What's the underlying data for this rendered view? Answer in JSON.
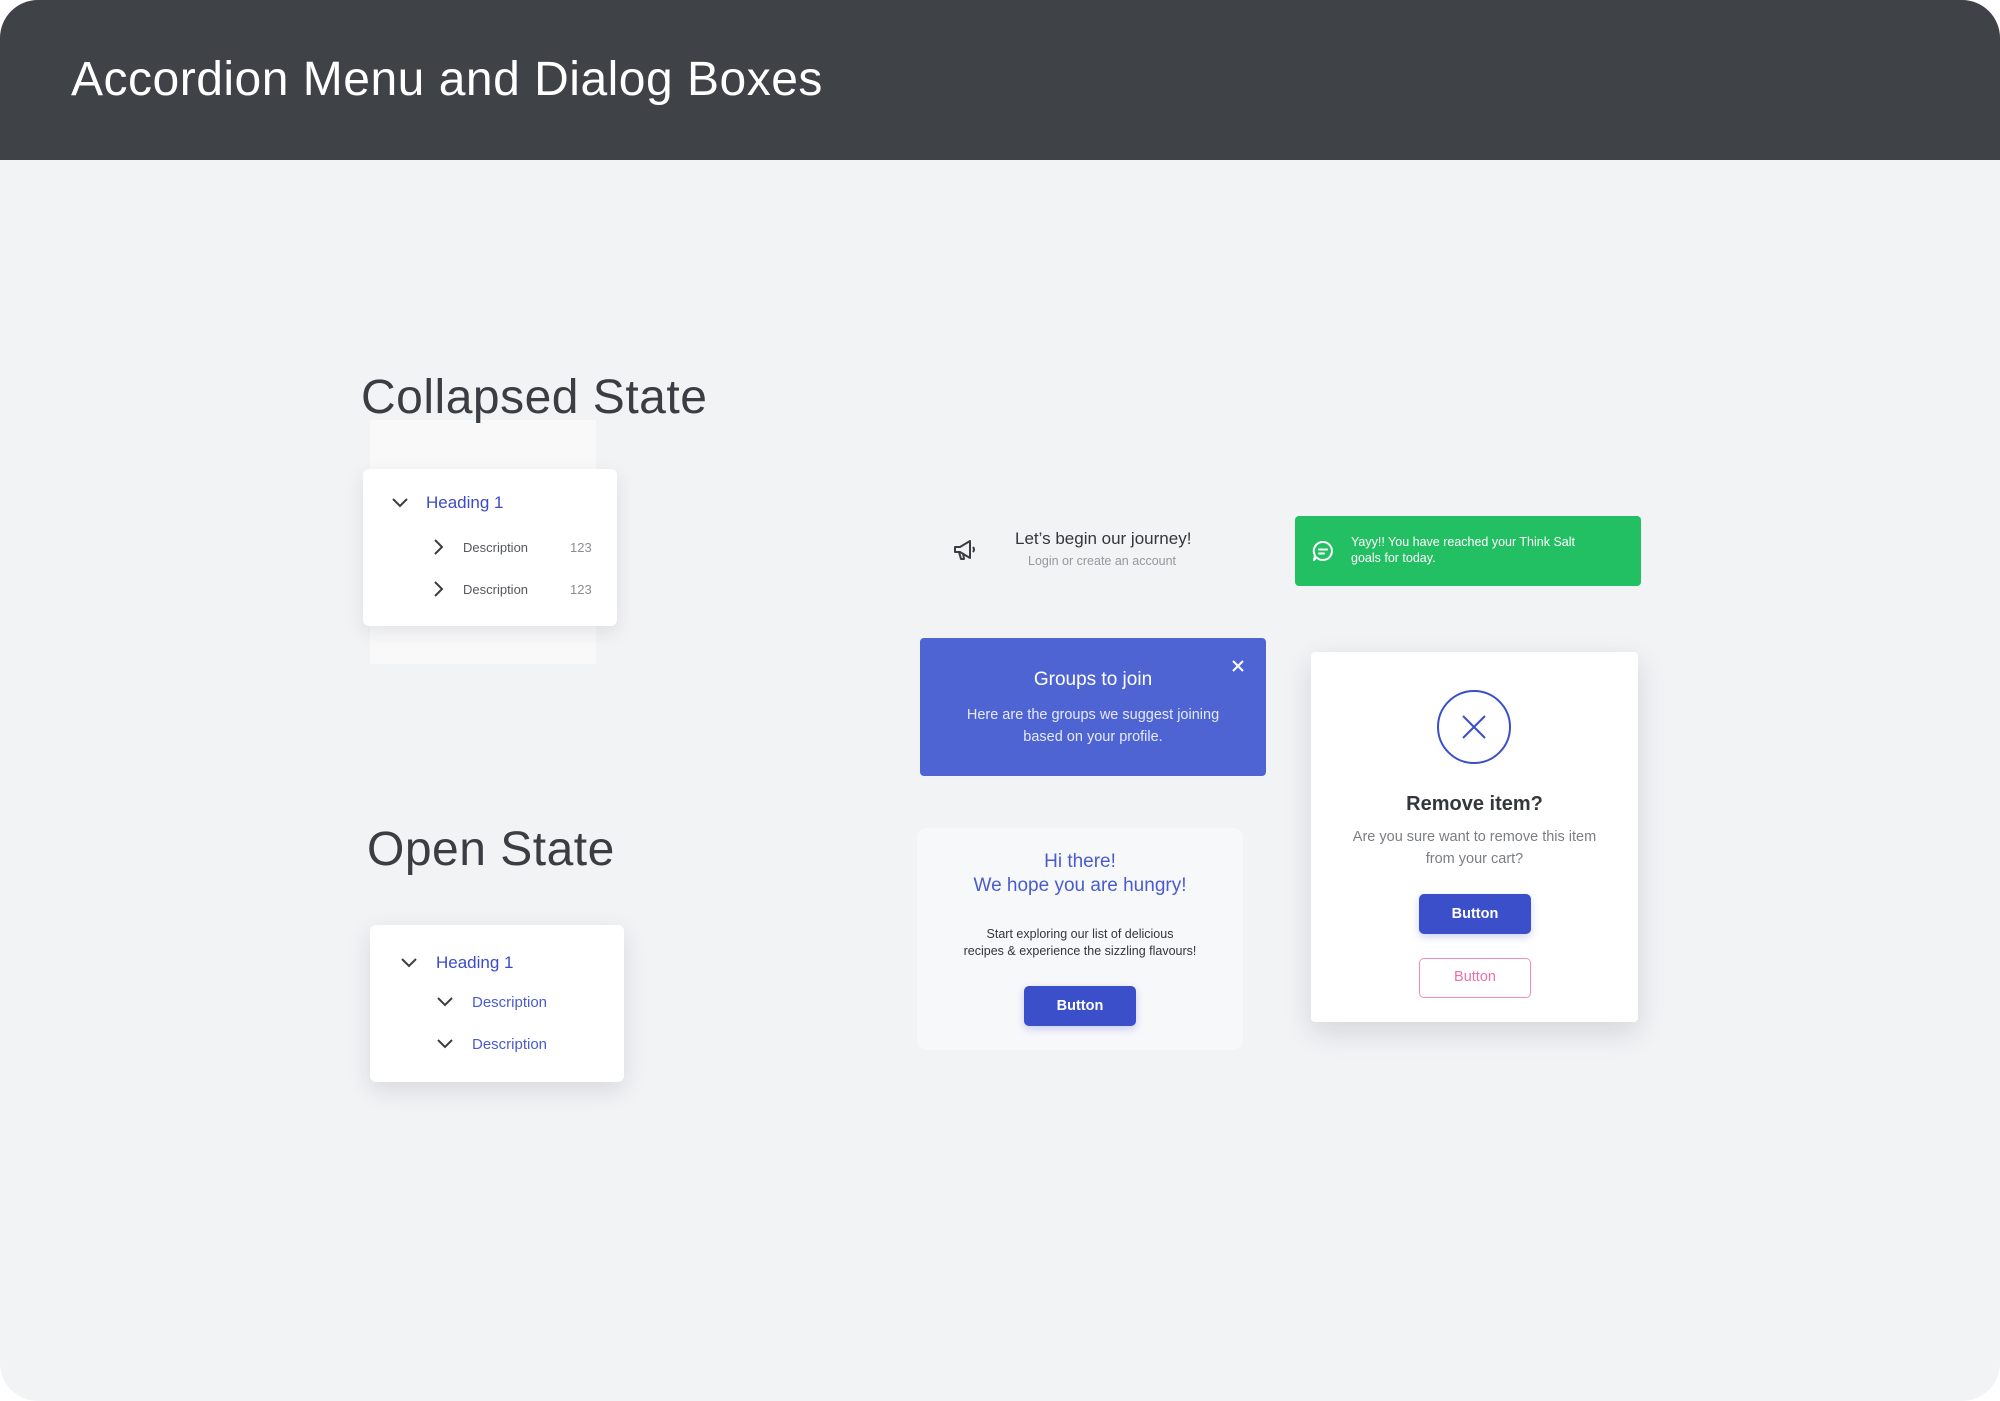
{
  "header": {
    "title": "Accordion Menu and Dialog Boxes"
  },
  "sections": {
    "collapsed_title": "Collapsed State",
    "open_title": "Open State"
  },
  "accordion_collapsed": {
    "heading": "Heading 1",
    "items": [
      {
        "label": "Description",
        "count": "123"
      },
      {
        "label": "Description",
        "count": "123"
      }
    ]
  },
  "accordion_open": {
    "heading": "Heading 1",
    "items": [
      {
        "label": "Description"
      },
      {
        "label": "Description"
      }
    ]
  },
  "journey": {
    "title": "Let’s begin our journey!",
    "subtitle": "Login or create an account"
  },
  "toast": {
    "line1": "Yayy!! You have reached your Think Salt",
    "line2": "goals for today."
  },
  "groups": {
    "title": "Groups to join",
    "line1": "Here are the groups we suggest joining",
    "line2": "based on your profile."
  },
  "hungry": {
    "title_line1": "Hi there!",
    "title_line2": "We hope you are hungry!",
    "text_line1": "Start exploring our list of delicious",
    "text_line2": "recipes & experience the sizzling flavours!",
    "button": "Button"
  },
  "remove": {
    "title": "Remove item?",
    "line1": "Are you sure want to remove this item",
    "line2": "from your cart?",
    "primary_button": "Button",
    "secondary_button": "Button"
  },
  "colors": {
    "header": "#3f4347",
    "background": "#f2f3f5",
    "accent": "#3a4fc9",
    "success": "#23bf63",
    "danger_outline": "#f28bb7"
  }
}
